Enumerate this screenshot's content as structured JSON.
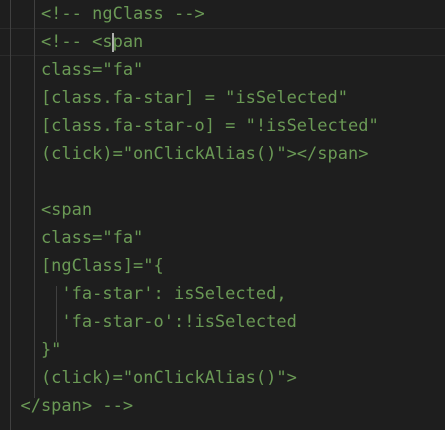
{
  "editor": {
    "lines": [
      "    <!-- ngClass -->",
      "    <!-- <span",
      "    class=\"fa\"",
      "    [class.fa-star] = \"isSelected\"",
      "    [class.fa-star-o] = \"!isSelected\"",
      "    (click)=\"onClickAlias()\"></span>",
      "",
      "    <span",
      "    class=\"fa\"",
      "    [ngClass]=\"{",
      "      'fa-star': isSelected,",
      "      'fa-star-o':!isSelected",
      "    }\"",
      "    (click)=\"onClickAlias()\">",
      "  </span> -->"
    ]
  },
  "colors": {
    "background": "#1e1e1e",
    "comment": "#6a9955",
    "indent_guide": "#404040",
    "cursor": "#aeafad"
  }
}
